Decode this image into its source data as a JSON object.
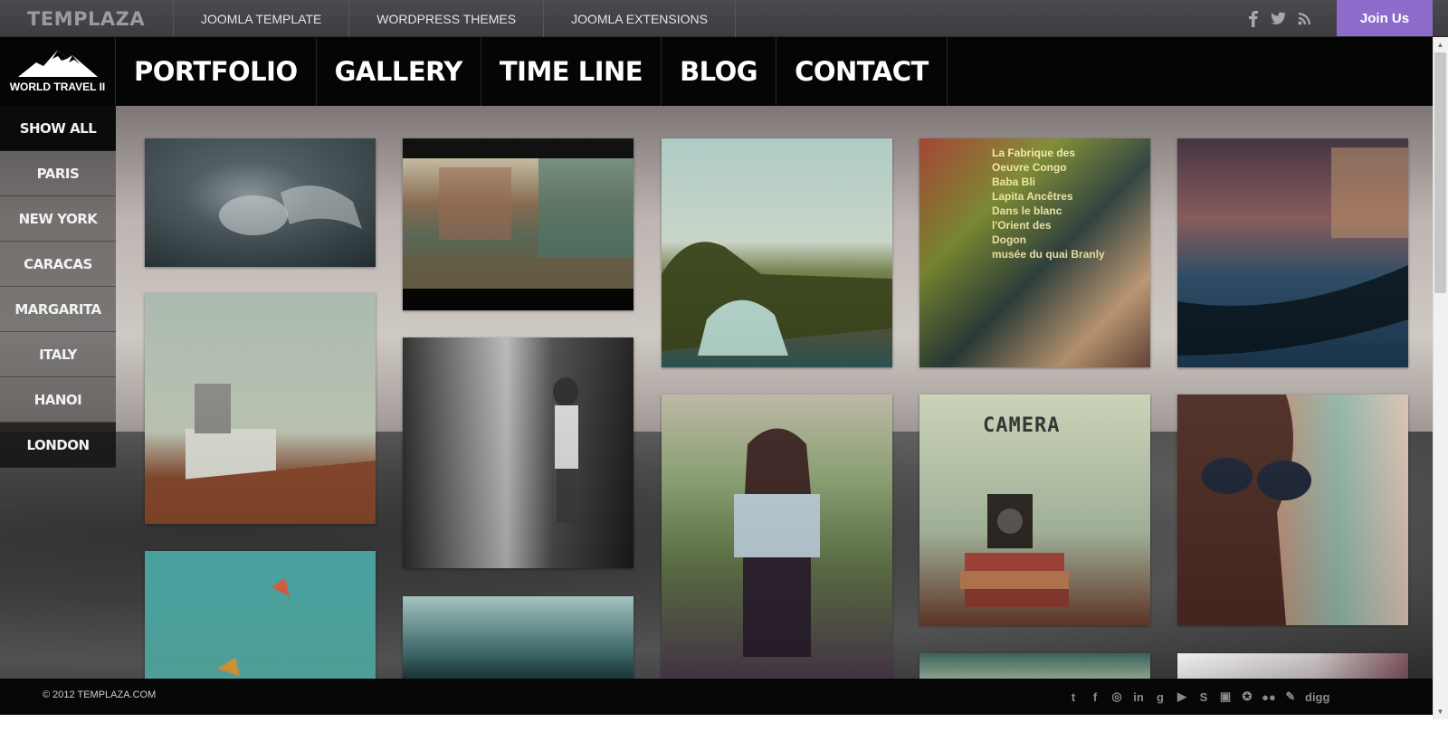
{
  "topbar": {
    "brand": "TEMPLAZA",
    "nav": [
      "JOOMLA TEMPLATE",
      "WORDPRESS THEMES",
      "JOOMLA EXTENSIONS"
    ],
    "social_icons": [
      "facebook-icon",
      "twitter-icon",
      "rss-icon"
    ],
    "join_label": "Join Us"
  },
  "logo": {
    "text": "WORLD TRAVEL II"
  },
  "main_menu": [
    "PORTFOLIO",
    "GALLERY",
    "TIME LINE",
    "BLOG",
    "CONTACT"
  ],
  "filters": [
    "SHOW ALL",
    "PARIS",
    "NEW YORK",
    "CARACAS",
    "MARGARITA",
    "ITALY",
    "HANOI",
    "LONDON"
  ],
  "gallery": {
    "camera_sign": "CAMERA",
    "paris_sign": "La Fabrique des\nOeuvre Congo\nBaba Bli\nLapita Ancêtres\nDans le blanc\nl'Orient des\nDogon\nmusée du quai Branly"
  },
  "footer": {
    "copyright": "© 2012 TEMPLAZA.COM",
    "social_icons": [
      "twitter-icon",
      "facebook-icon",
      "dribbble-icon",
      "linkedin-icon",
      "google-icon",
      "youtube-icon",
      "skype-icon",
      "instagram-icon",
      "picasa-icon",
      "flickr-icon",
      "deviantart-icon",
      "digg-icon"
    ]
  },
  "colors": {
    "accent": "#8e6ccc",
    "topbar": "#45454a",
    "nav": "#050505"
  }
}
